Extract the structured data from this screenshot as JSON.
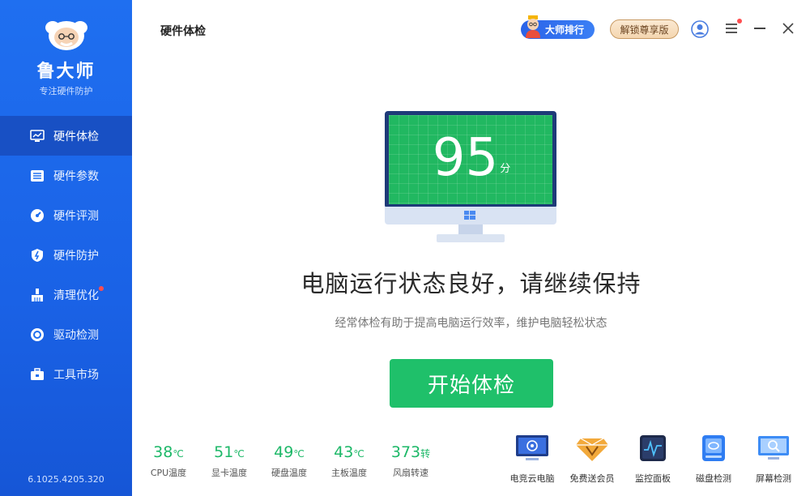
{
  "sidebar": {
    "brand_name": "鲁大师",
    "brand_sub": "专注硬件防护",
    "items": [
      {
        "label": "硬件体检"
      },
      {
        "label": "硬件参数"
      },
      {
        "label": "硬件评测"
      },
      {
        "label": "硬件防护"
      },
      {
        "label": "清理优化"
      },
      {
        "label": "驱动检测"
      },
      {
        "label": "工具市场"
      }
    ],
    "version": "6.1025.4205.320"
  },
  "header": {
    "title": "硬件体检",
    "rank_label": "大师排行",
    "vip_label": "解锁尊享版"
  },
  "main": {
    "score": "95",
    "score_unit": "分",
    "headline": "电脑运行状态良好，请继续保持",
    "subline": "经常体检有助于提高电脑运行效率，维护电脑轻松状态",
    "start_label": "开始体检"
  },
  "stats": [
    {
      "value": "38",
      "unit": "℃",
      "label": "CPU温度"
    },
    {
      "value": "51",
      "unit": "℃",
      "label": "显卡温度"
    },
    {
      "value": "49",
      "unit": "℃",
      "label": "硬盘温度"
    },
    {
      "value": "43",
      "unit": "℃",
      "label": "主板温度"
    },
    {
      "value": "373",
      "unit": "转",
      "label": "风扇转速"
    }
  ],
  "tools": [
    {
      "label": "电竞云电脑",
      "icon": "cloud-pc-icon"
    },
    {
      "label": "免费送会员",
      "icon": "vip-diamond-icon"
    },
    {
      "label": "监控面板",
      "icon": "monitor-panel-icon"
    },
    {
      "label": "磁盘检测",
      "icon": "disk-check-icon"
    },
    {
      "label": "屏幕检测",
      "icon": "screen-check-icon"
    }
  ],
  "colors": {
    "sidebar": "#1f6ff0",
    "accent_green": "#1fc06a",
    "screen_frame": "#1e3a78"
  }
}
